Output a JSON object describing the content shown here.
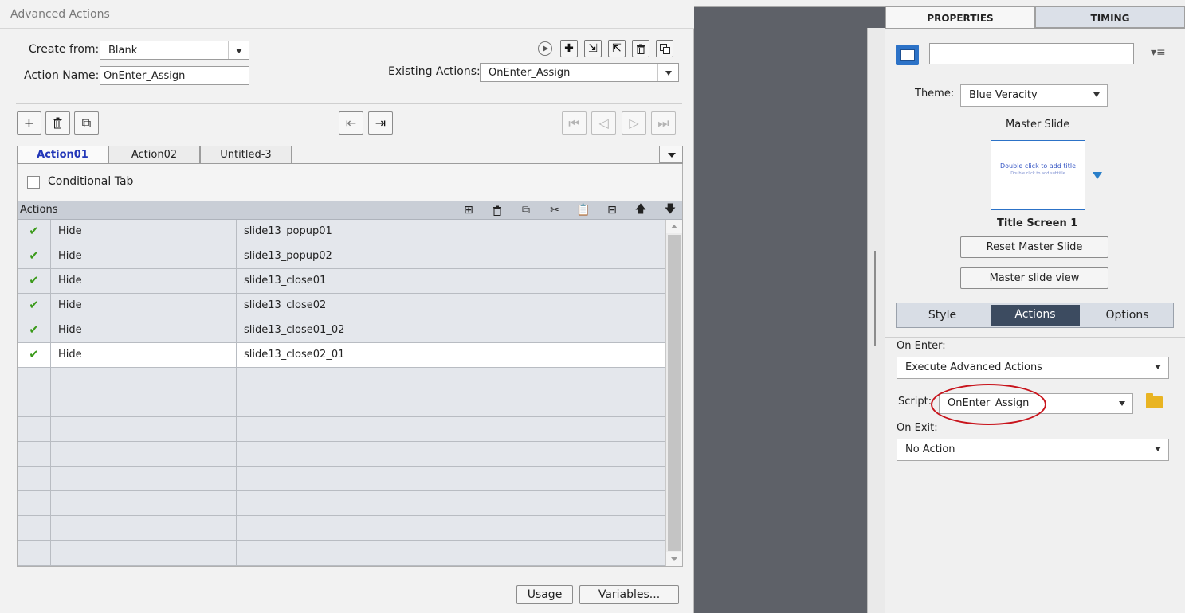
{
  "dialog": {
    "title": "Advanced Actions",
    "create_from_label": "Create from:",
    "create_from_value": "Blank",
    "action_name_label": "Action Name:",
    "action_name_value": "OnEnter_Assign",
    "existing_actions_label": "Existing Actions:",
    "existing_actions_value": "OnEnter_Assign",
    "tabs": [
      {
        "label": "Action01",
        "active": true
      },
      {
        "label": "Action02",
        "active": false
      },
      {
        "label": "Untitled-3",
        "active": false
      }
    ],
    "conditional_tab_label": "Conditional Tab",
    "actions_header": "Actions",
    "rows": [
      {
        "status": "check",
        "action": "Hide",
        "target": "slide13_popup01",
        "selected": false
      },
      {
        "status": "check",
        "action": "Hide",
        "target": "slide13_popup02",
        "selected": false
      },
      {
        "status": "check",
        "action": "Hide",
        "target": "slide13_close01",
        "selected": false
      },
      {
        "status": "check",
        "action": "Hide",
        "target": "slide13_close02",
        "selected": false
      },
      {
        "status": "check",
        "action": "Hide",
        "target": "slide13_close01_02",
        "selected": false
      },
      {
        "status": "check",
        "action": "Hide",
        "target": "slide13_close02_01",
        "selected": true
      }
    ],
    "empty_rows": 8,
    "usage_button": "Usage",
    "variables_button": "Variables..."
  },
  "properties": {
    "tabs": [
      "PROPERTIES",
      "TIMING"
    ],
    "name_value": "",
    "theme_label": "Theme:",
    "theme_value": "Blue Veracity",
    "master_slide_label": "Master Slide",
    "thumbnail_title": "Double click to add title",
    "thumbnail_subtitle": "Double click to add subtitle",
    "slide_name": "Title Screen 1",
    "reset_button": "Reset Master Slide",
    "view_button": "Master slide view",
    "segments": [
      "Style",
      "Actions",
      "Options"
    ],
    "active_segment": "Actions",
    "on_enter_label": "On Enter:",
    "on_enter_value": "Execute Advanced Actions",
    "script_label": "Script:",
    "script_value": "OnEnter_Assign",
    "on_exit_label": "On Exit:",
    "on_exit_value": "No Action"
  },
  "colors": {
    "accent": "#2c72c7",
    "active_tab_text": "#2236b8",
    "annotation_red": "#c8141c",
    "check_green": "#3a9a1a",
    "segment_active": "#3c4b60"
  }
}
